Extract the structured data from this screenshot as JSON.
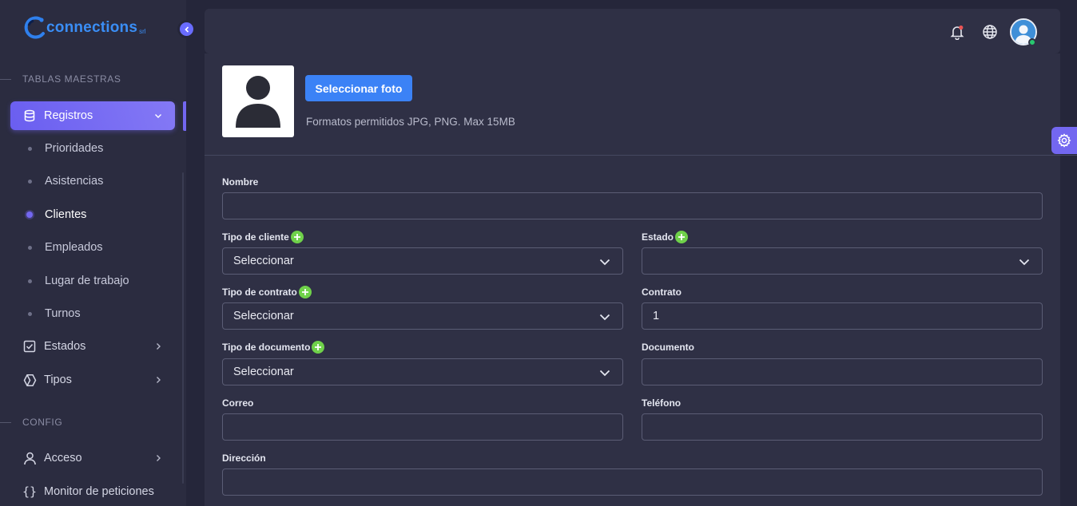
{
  "brand": {
    "name": "connections",
    "suffix": "srl"
  },
  "sidebar": {
    "sections": [
      {
        "title": "TABLAS MAESTRAS"
      },
      {
        "title": "CONFIG"
      }
    ],
    "registros": {
      "label": "Registros",
      "children": [
        "Prioridades",
        "Asistencias",
        "Clientes",
        "Empleados",
        "Lugar de trabajo",
        "Turnos"
      ],
      "current": "Clientes"
    },
    "estados": {
      "label": "Estados"
    },
    "tipos": {
      "label": "Tipos"
    },
    "acceso": {
      "label": "Acceso"
    },
    "monitor": {
      "label": "Monitor de peticiones"
    }
  },
  "photo": {
    "button_label": "Seleccionar foto",
    "hint": "Formatos permitidos JPG, PNG. Max 15MB"
  },
  "form": {
    "nombre": {
      "label": "Nombre",
      "value": ""
    },
    "tipo_cliente": {
      "label": "Tipo de cliente",
      "value": "Seleccionar"
    },
    "estado": {
      "label": "Estado",
      "value": ""
    },
    "tipo_contrato": {
      "label": "Tipo de contrato",
      "value": "Seleccionar"
    },
    "contrato": {
      "label": "Contrato",
      "value": "1"
    },
    "tipo_documento": {
      "label": "Tipo de documento",
      "value": "Seleccionar"
    },
    "documento": {
      "label": "Documento",
      "value": ""
    },
    "correo": {
      "label": "Correo",
      "value": ""
    },
    "telefono": {
      "label": "Teléfono",
      "value": ""
    },
    "direccion": {
      "label": "Dirección",
      "value": ""
    }
  },
  "colors": {
    "accent": "#7367f0",
    "primary_button": "#3b82f6",
    "add_icon": "#6fd14a",
    "notification_dot": "#ea5455",
    "online": "#28c76f"
  },
  "icons": {
    "notifications": "bell-icon",
    "language": "globe-icon",
    "settings": "gear-icon"
  }
}
